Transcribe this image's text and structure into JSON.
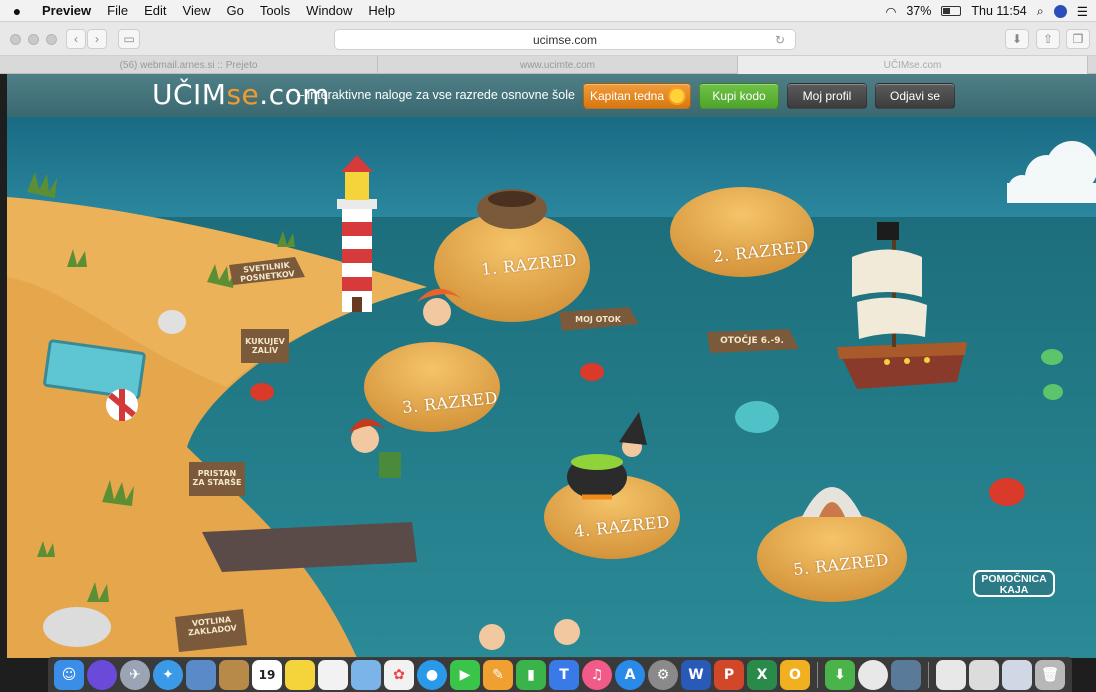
{
  "menubar": {
    "app": "Preview",
    "items": [
      "File",
      "Edit",
      "View",
      "Go",
      "Tools",
      "Window",
      "Help"
    ],
    "battery": "37%",
    "clock": "Thu 11:54"
  },
  "browser": {
    "url": "ucimse.com",
    "tabs": [
      "(56) webmail.arnes.si :: Prejeto",
      "www.ucimte.com",
      "UČIMse.com"
    ]
  },
  "site": {
    "logo_main": "UČIM",
    "logo_se": "se",
    "logo_tld": ".com",
    "tagline": "–  interaktivne naloge za vse razrede osnovne šole",
    "buttons": {
      "captain": "Kapitan tedna",
      "buy": "Kupi kodo",
      "profile": "Moj profil",
      "logout": "Odjavi se"
    }
  },
  "scene": {
    "islands": [
      "1. RAZRED",
      "2. RAZRED",
      "3. RAZRED",
      "4. RAZRED",
      "5. RAZRED"
    ],
    "signs": {
      "lighthouse": "SVETILNIK\nPOSNETKOV",
      "kukuje": "KUKUJEV\nZALIV",
      "moj_otok": "MOJ OTOK",
      "otocje": "OTOČJE 6.-9.",
      "pristan": "PRISTAN\nZA STARŠE",
      "votlina": "VOTLINA\nZAKLADOV"
    },
    "helper": "POMOČNICA\nKAJA"
  },
  "dock": {
    "icons": [
      "finder-icon",
      "siri-icon",
      "launchpad-icon",
      "safari-icon",
      "preview-icon",
      "contacts-icon",
      "calendar-icon",
      "notes-icon",
      "reminders-icon",
      "photos-icon",
      "photos-app-icon",
      "messages-icon",
      "facetime-icon",
      "pages-icon",
      "numbers-icon",
      "keynote-icon",
      "itunes-icon",
      "app-store-icon",
      "system-preferences-icon",
      "word-icon",
      "powerpoint-icon",
      "excel-icon",
      "outlook-icon",
      "downloads-icon",
      "chrome-icon",
      "image-capture-icon",
      "documents-icon",
      "screenshots-icon",
      "folder-icon",
      "trash-icon"
    ],
    "calendar_day": "19"
  }
}
